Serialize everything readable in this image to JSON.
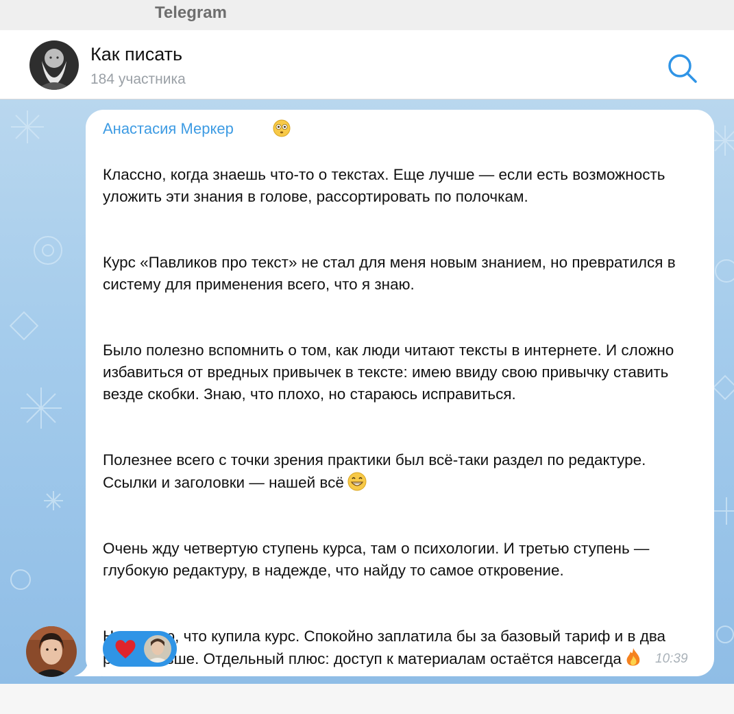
{
  "app": {
    "title": "Telegram"
  },
  "chat": {
    "title": "Как писать",
    "subtitle": "184 участника",
    "avatar_icon": "tolstoy-portrait"
  },
  "header": {
    "search_icon": "search-icon"
  },
  "message": {
    "sender": "Анастасия Меркер",
    "sender_emoji": "flushed-face",
    "paragraphs": [
      "Классно, когда знаешь что-то о текстах. Еще лучше — если есть возможность уложить эти знания в голове, рассортировать по полочкам.",
      "Курс «Павликов про текст» не стал для меня новым знанием, но превратился в систему для применения всего, что я знаю.",
      "Было полезно вспомнить о том, как люди читают тексты в интернете. И сложно избавиться от вредных привычек в тексте: имею ввиду свою привычку ставить везде скобки. Знаю, что плохо, но стараюсь исправиться.",
      "Полезнее всего с точки зрения практики был всё-таки раздел по редактуре. Ссылки и заголовки — нашей всё",
      "Очень жду четвертую ступень курса, там о психологии. И третью ступень — глубокую редактуру, в надежде, что найду то самое откровение.",
      "Не жалею, что купила курс. Спокойно заплатила бы за базовый тариф и в два раза больше. Отдельный плюс: доступ к материалам остаётся навсегда"
    ],
    "time": "10:39",
    "reaction": {
      "emoji": "heart",
      "count_avatars": 1
    }
  },
  "colors": {
    "accent": "#3d9be3",
    "reaction_bg": "#2f94e6",
    "chat_bg": "#a5ccec"
  }
}
